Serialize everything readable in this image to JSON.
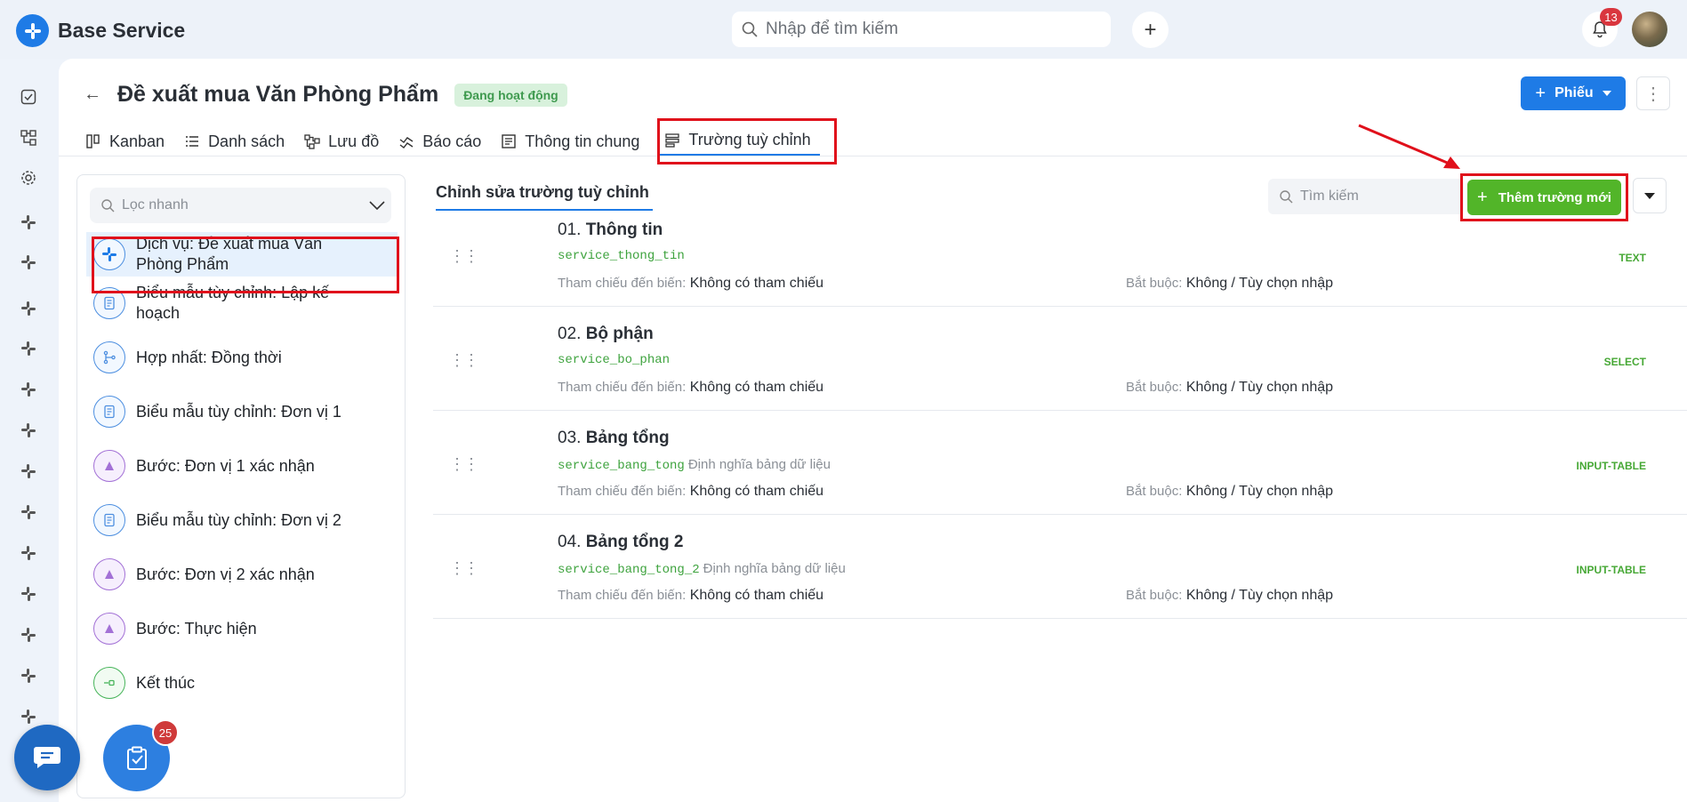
{
  "app": {
    "name": "Base Service",
    "brand_color": "#1e7be6"
  },
  "topbar": {
    "search_placeholder": "Nhập để tìm kiếm",
    "notification_count": "13"
  },
  "page": {
    "title": "Đề xuất mua Văn Phòng Phẩm",
    "status": "Đang hoạt động",
    "primary_button": "Phiếu"
  },
  "tabs": [
    {
      "label": "Kanban",
      "icon": "kanban-icon"
    },
    {
      "label": "Danh sách",
      "icon": "list-icon"
    },
    {
      "label": "Lưu đồ",
      "icon": "flow-icon"
    },
    {
      "label": "Báo cáo",
      "icon": "report-icon"
    },
    {
      "label": "Thông tin chung",
      "icon": "info-icon"
    },
    {
      "label": "Trường tuỳ chỉnh",
      "icon": "fields-icon",
      "active": true
    }
  ],
  "left_panel": {
    "filter_placeholder": "Lọc nhanh",
    "items": [
      {
        "label": "Dịch vụ: Đề xuất mua Văn Phòng Phẩm",
        "icon": "service-icon",
        "active": true
      },
      {
        "label": "Biểu mẫu tùy chỉnh: Lập kế hoạch",
        "icon": "form-icon"
      },
      {
        "label": "Hợp nhất: Đồng thời",
        "icon": "merge-icon"
      },
      {
        "label": "Biểu mẫu tùy chỉnh: Đơn vị 1",
        "icon": "form-icon"
      },
      {
        "label": "Bước: Đơn vị 1 xác nhận",
        "icon": "step-icon"
      },
      {
        "label": "Biểu mẫu tùy chỉnh: Đơn vị 2",
        "icon": "form-icon"
      },
      {
        "label": "Bước: Đơn vị 2 xác nhận",
        "icon": "step-icon"
      },
      {
        "label": "Bước: Thực hiện",
        "icon": "step-icon"
      },
      {
        "label": "Kết thúc",
        "icon": "end-icon"
      }
    ]
  },
  "fields_panel": {
    "subtab": "Chỉnh sửa trường tuỳ chỉnh",
    "search_placeholder": "Tìm kiếm",
    "add_button": "Thêm trường mới",
    "ref_label": "Tham chiếu đến biến:",
    "required_label": "Bắt buộc:",
    "fields": [
      {
        "index": "01.",
        "name": "Thông tin",
        "key": "service_thong_tin",
        "definition": "",
        "type": "TEXT",
        "ref": "Không có tham chiếu",
        "required": "Không / Tùy chọn nhập"
      },
      {
        "index": "02.",
        "name": "Bộ phận",
        "key": "service_bo_phan",
        "definition": "",
        "type": "SELECT",
        "ref": "Không có tham chiếu",
        "required": "Không / Tùy chọn nhập"
      },
      {
        "index": "03.",
        "name": "Bảng tổng",
        "key": "service_bang_tong",
        "definition": "Định nghĩa bảng dữ liệu",
        "type": "INPUT-TABLE",
        "ref": "Không có tham chiếu",
        "required": "Không / Tùy chọn nhập"
      },
      {
        "index": "04.",
        "name": "Bảng tổng 2",
        "key": "service_bang_tong_2",
        "definition": "Định nghĩa bảng dữ liệu",
        "type": "INPUT-TABLE",
        "ref": "Không có tham chiếu",
        "required": "Không / Tùy chọn nhập"
      }
    ]
  },
  "floating": {
    "task_count": "25"
  },
  "colors": {
    "accent": "#1e7be6",
    "success": "#52b529",
    "highlight": "#e0101b"
  }
}
